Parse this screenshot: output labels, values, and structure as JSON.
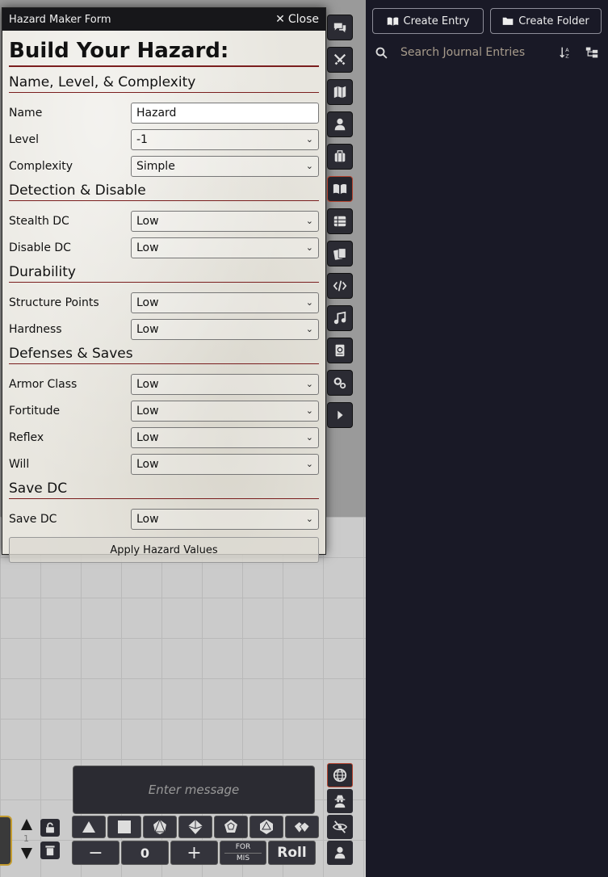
{
  "window": {
    "title": "Hazard Maker Form",
    "close_label": "Close"
  },
  "form": {
    "heading": "Build Your Hazard:",
    "sections": {
      "name_level": "Name, Level, & Complexity",
      "detection": "Detection & Disable",
      "durability": "Durability",
      "defenses": "Defenses & Saves",
      "save_dc": "Save DC"
    },
    "fields": {
      "name": {
        "label": "Name",
        "value": "Hazard"
      },
      "level": {
        "label": "Level",
        "value": "-1"
      },
      "complexity": {
        "label": "Complexity",
        "value": "Simple"
      },
      "stealth_dc": {
        "label": "Stealth DC",
        "value": "Low"
      },
      "disable_dc": {
        "label": "Disable DC",
        "value": "Low"
      },
      "structure_points": {
        "label": "Structure Points",
        "value": "Low"
      },
      "hardness": {
        "label": "Hardness",
        "value": "Low"
      },
      "armor_class": {
        "label": "Armor Class",
        "value": "Low"
      },
      "fortitude": {
        "label": "Fortitude",
        "value": "Low"
      },
      "reflex": {
        "label": "Reflex",
        "value": "Low"
      },
      "will": {
        "label": "Will",
        "value": "Low"
      },
      "save_dc": {
        "label": "Save DC",
        "value": "Low"
      }
    },
    "apply_label": "Apply Hazard Values"
  },
  "sidebar": {
    "create_entry": "Create Entry",
    "create_folder": "Create Folder",
    "search_placeholder": "Search Journal Entries",
    "tabs": [
      "chat-icon",
      "combat-icon",
      "scenes-icon",
      "actors-icon",
      "items-icon",
      "journal-icon",
      "tables-icon",
      "cards-icon",
      "macros-icon",
      "playlists-icon",
      "compendium-icon",
      "settings-icon",
      "collapse-icon"
    ]
  },
  "chat": {
    "placeholder": "Enter message",
    "dice": [
      "d4-icon",
      "d6-icon",
      "d8-icon",
      "d10-icon",
      "d12-icon",
      "d20-icon",
      "d100-icon"
    ],
    "minus": "−",
    "modifier": "0",
    "plus": "+",
    "for_label": "FOR",
    "mis_label": "MIS",
    "roll_label": "Roll"
  },
  "hotbar": {
    "page": "1"
  },
  "colors": {
    "accent": "#7a1e1e",
    "sidebar_bg": "#191926",
    "active_border": "#b5432e"
  }
}
